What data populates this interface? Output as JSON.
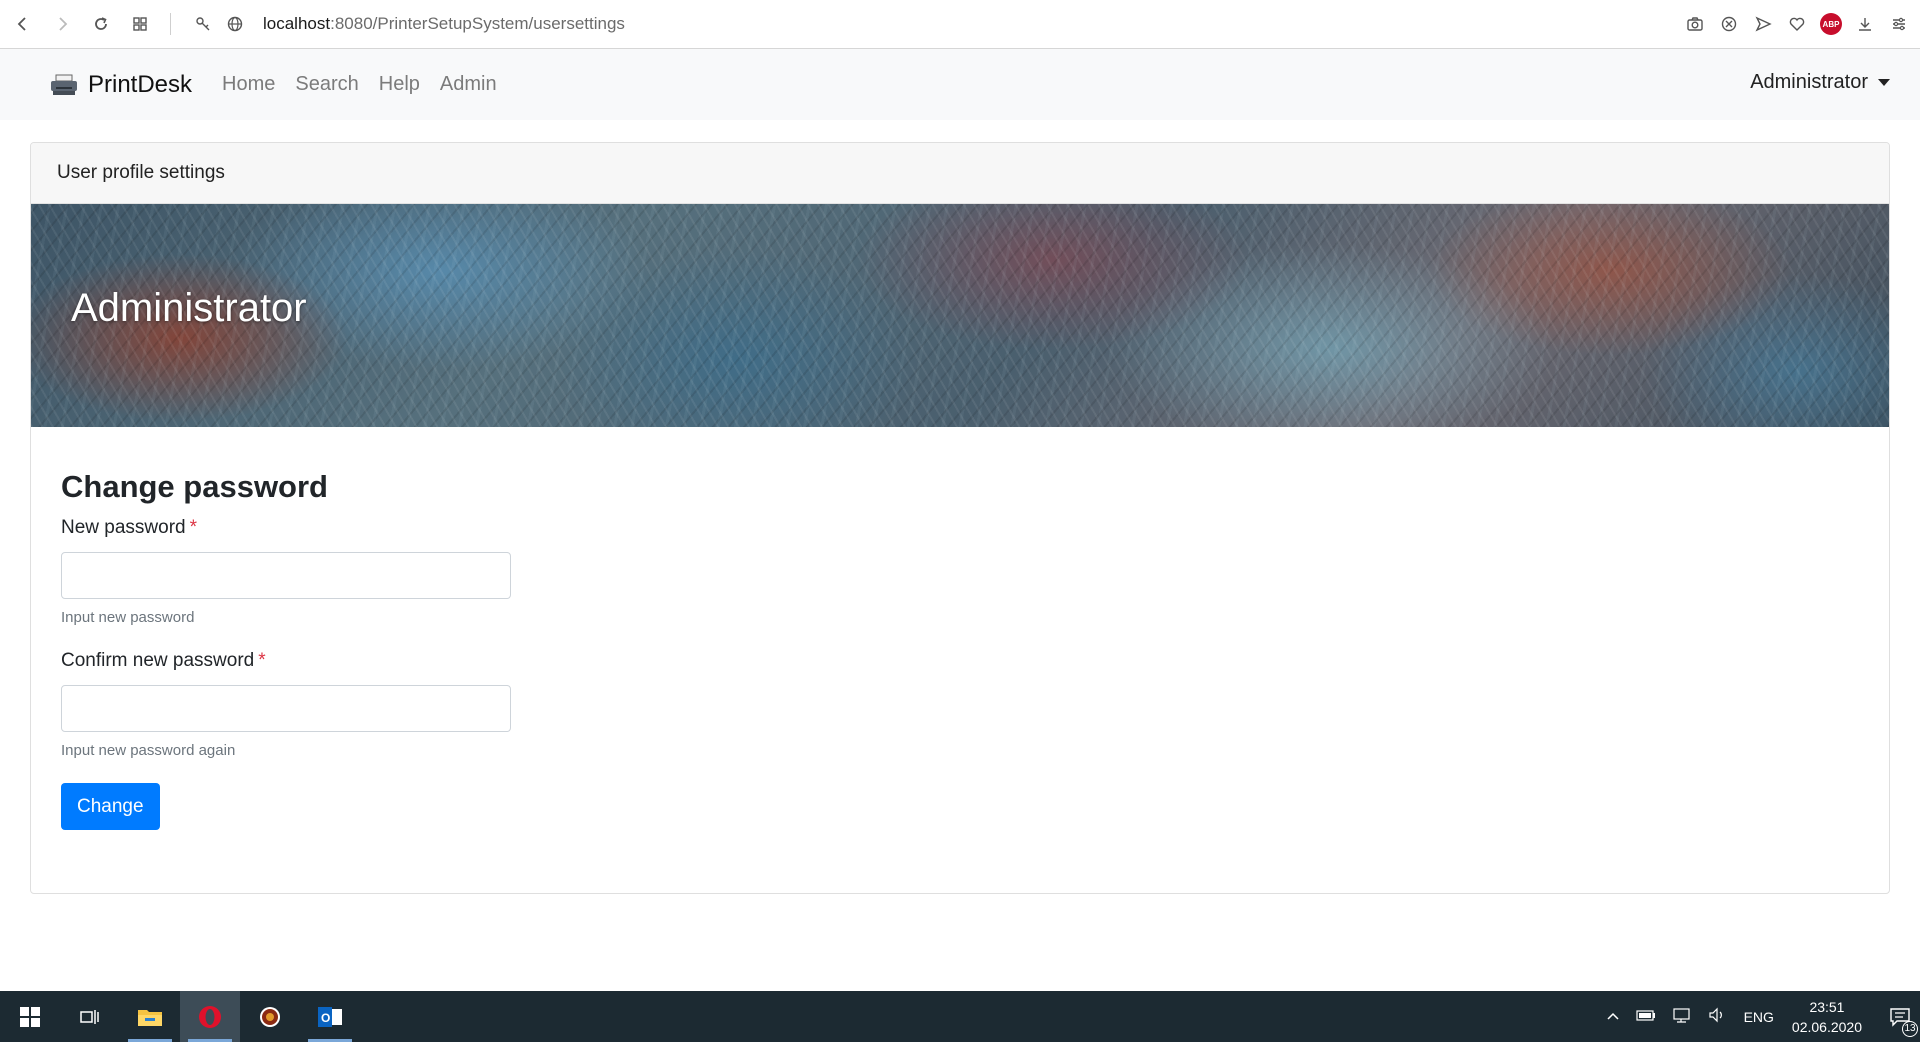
{
  "browser": {
    "url_host": "localhost",
    "url_path": ":8080/PrinterSetupSystem/usersettings"
  },
  "navbar": {
    "brand": "PrintDesk",
    "links": [
      {
        "label": "Home"
      },
      {
        "label": "Search"
      },
      {
        "label": "Help"
      },
      {
        "label": "Admin"
      }
    ],
    "user": "Administrator"
  },
  "card": {
    "header": "User profile settings",
    "banner_name": "Administrator"
  },
  "form": {
    "title": "Change password",
    "new_password_label": "New password",
    "new_password_help": "Input new password",
    "confirm_password_label": "Confirm new password",
    "confirm_password_help": "Input new password again",
    "required_mark": "*",
    "submit_label": "Change"
  },
  "taskbar": {
    "language": "ENG",
    "time": "23:51",
    "date": "02.06.2020",
    "notification_count": "13"
  },
  "colors": {
    "primary": "#007bff",
    "navbar_bg": "#f8f9fa",
    "taskbar_bg": "#1c2a32",
    "required": "#dc3545"
  }
}
